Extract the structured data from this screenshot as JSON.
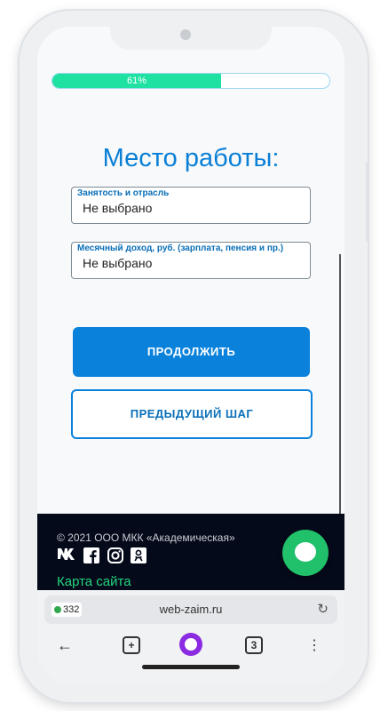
{
  "progress": {
    "label": "61%",
    "value": 0.61
  },
  "form": {
    "title": "Место работы:",
    "fields": [
      {
        "label": "Занятость и отрасль",
        "value": "Не выбрано"
      },
      {
        "label": "Месячный доход, руб. (зарплата, пенсия и пр.)",
        "value": "Не выбрано"
      }
    ],
    "continue_label": "ПРОДОЛЖИТЬ",
    "back_label": "ПРЕДЫДУЩИЙ ШАГ"
  },
  "footer": {
    "copyright": "© 2021 ООО МКК «Академическая»",
    "socials": [
      "vk-icon",
      "facebook-icon",
      "instagram-icon",
      "odnoklassniki-icon"
    ],
    "sitemap": "Карта сайта"
  },
  "browser": {
    "badge_count": "332",
    "url": "web-zaim.ru",
    "tabs_count": "3"
  },
  "colors": {
    "accent": "#0a82dc",
    "progress": "#1fe2a2",
    "footer_bg": "#050a1a",
    "chat_button": "#21c06a",
    "sitemap_link": "#21d67f"
  }
}
